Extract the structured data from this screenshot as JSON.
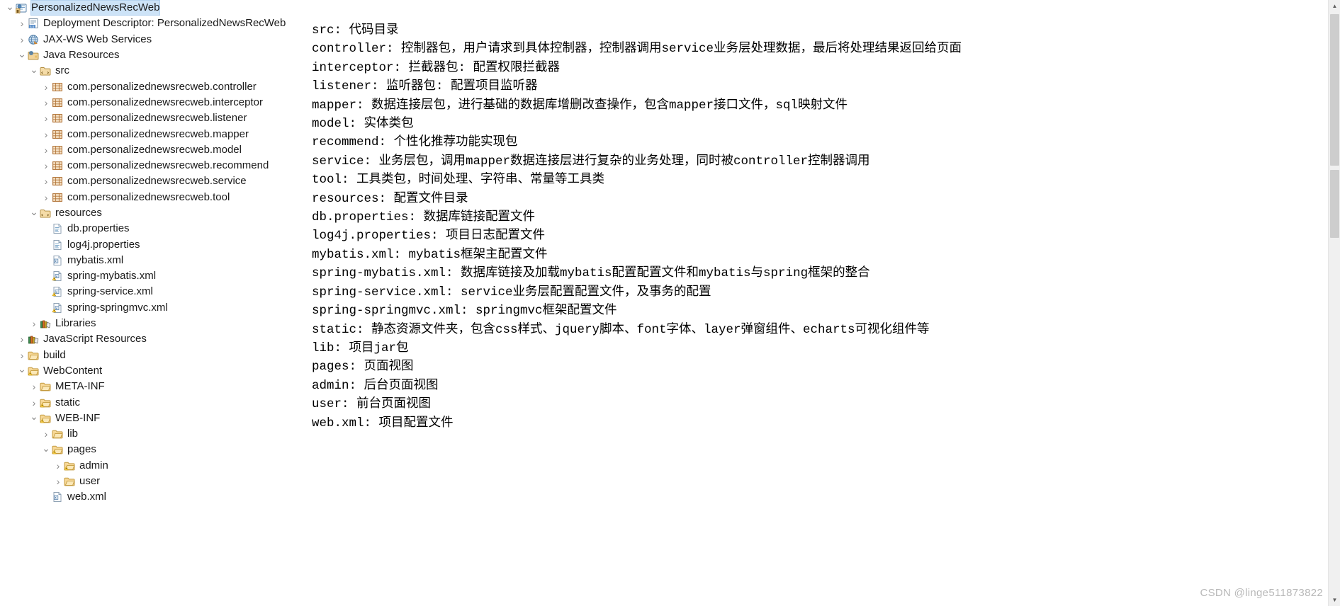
{
  "tree": {
    "items": [
      {
        "label": "PersonalizedNewsRecWeb",
        "depth": 0,
        "twisty": "expanded",
        "icon": "java-web-project-icon",
        "selected": true
      },
      {
        "label": "Deployment Descriptor: PersonalizedNewsRecWeb",
        "depth": 1,
        "twisty": "collapsed",
        "icon": "deployment-descriptor-icon",
        "selected": false
      },
      {
        "label": "JAX-WS Web Services",
        "depth": 1,
        "twisty": "collapsed",
        "icon": "jaxws-icon",
        "selected": false
      },
      {
        "label": "Java Resources",
        "depth": 1,
        "twisty": "expanded",
        "icon": "java-resources-icon",
        "selected": false
      },
      {
        "label": "src",
        "depth": 2,
        "twisty": "expanded",
        "icon": "source-folder-icon",
        "selected": false
      },
      {
        "label": "com.personalizednewsrecweb.controller",
        "depth": 3,
        "twisty": "collapsed",
        "icon": "package-icon",
        "selected": false
      },
      {
        "label": "com.personalizednewsrecweb.interceptor",
        "depth": 3,
        "twisty": "collapsed",
        "icon": "package-icon",
        "selected": false
      },
      {
        "label": "com.personalizednewsrecweb.listener",
        "depth": 3,
        "twisty": "collapsed",
        "icon": "package-icon",
        "selected": false
      },
      {
        "label": "com.personalizednewsrecweb.mapper",
        "depth": 3,
        "twisty": "collapsed",
        "icon": "package-icon",
        "selected": false
      },
      {
        "label": "com.personalizednewsrecweb.model",
        "depth": 3,
        "twisty": "collapsed",
        "icon": "package-icon",
        "selected": false
      },
      {
        "label": "com.personalizednewsrecweb.recommend",
        "depth": 3,
        "twisty": "collapsed",
        "icon": "package-icon",
        "selected": false
      },
      {
        "label": "com.personalizednewsrecweb.service",
        "depth": 3,
        "twisty": "collapsed",
        "icon": "package-icon",
        "selected": false
      },
      {
        "label": "com.personalizednewsrecweb.tool",
        "depth": 3,
        "twisty": "collapsed",
        "icon": "package-icon",
        "selected": false
      },
      {
        "label": "resources",
        "depth": 2,
        "twisty": "expanded",
        "icon": "source-folder-icon",
        "selected": false
      },
      {
        "label": "db.properties",
        "depth": 3,
        "twisty": "none",
        "icon": "properties-file-icon",
        "selected": false
      },
      {
        "label": "log4j.properties",
        "depth": 3,
        "twisty": "none",
        "icon": "properties-file-icon",
        "selected": false
      },
      {
        "label": "mybatis.xml",
        "depth": 3,
        "twisty": "none",
        "icon": "xml-file-icon",
        "selected": false
      },
      {
        "label": "spring-mybatis.xml",
        "depth": 3,
        "twisty": "none",
        "icon": "xml-warning-file-icon",
        "selected": false
      },
      {
        "label": "spring-service.xml",
        "depth": 3,
        "twisty": "none",
        "icon": "xml-warning-file-icon",
        "selected": false
      },
      {
        "label": "spring-springmvc.xml",
        "depth": 3,
        "twisty": "none",
        "icon": "xml-warning-file-icon",
        "selected": false
      },
      {
        "label": "Libraries",
        "depth": 2,
        "twisty": "collapsed",
        "icon": "libraries-icon",
        "selected": false
      },
      {
        "label": "JavaScript Resources",
        "depth": 1,
        "twisty": "collapsed",
        "icon": "libraries-icon",
        "selected": false
      },
      {
        "label": "build",
        "depth": 1,
        "twisty": "collapsed",
        "icon": "folder-icon",
        "selected": false
      },
      {
        "label": "WebContent",
        "depth": 1,
        "twisty": "expanded",
        "icon": "folder-warning-icon",
        "selected": false
      },
      {
        "label": "META-INF",
        "depth": 2,
        "twisty": "collapsed",
        "icon": "folder-icon",
        "selected": false
      },
      {
        "label": "static",
        "depth": 2,
        "twisty": "collapsed",
        "icon": "folder-warning-icon",
        "selected": false
      },
      {
        "label": "WEB-INF",
        "depth": 2,
        "twisty": "expanded",
        "icon": "folder-warning-icon",
        "selected": false
      },
      {
        "label": "lib",
        "depth": 3,
        "twisty": "collapsed",
        "icon": "folder-icon",
        "selected": false
      },
      {
        "label": "pages",
        "depth": 3,
        "twisty": "expanded",
        "icon": "folder-warning-icon",
        "selected": false
      },
      {
        "label": "admin",
        "depth": 4,
        "twisty": "collapsed",
        "icon": "folder-warning-icon",
        "selected": false
      },
      {
        "label": "user",
        "depth": 4,
        "twisty": "collapsed",
        "icon": "folder-icon",
        "selected": false
      },
      {
        "label": "web.xml",
        "depth": 3,
        "twisty": "none",
        "icon": "xml-file-icon",
        "selected": false
      }
    ]
  },
  "doc": {
    "lines": [
      "src: 代码目录",
      "controller: 控制器包，用户请求到具体控制器，控制器调用service业务层处理数据，最后将处理结果返回给页面",
      "interceptor: 拦截器包: 配置权限拦截器",
      "listener: 监听器包: 配置项目监听器",
      "mapper: 数据连接层包，进行基础的数据库增删改查操作，包含mapper接口文件，sql映射文件",
      "model: 实体类包",
      "recommend: 个性化推荐功能实现包",
      "service: 业务层包，调用mapper数据连接层进行复杂的业务处理，同时被controller控制器调用",
      "tool: 工具类包，时间处理、字符串、常量等工具类",
      "resources: 配置文件目录",
      "db.properties: 数据库链接配置文件",
      "log4j.properties: 项目日志配置文件",
      "mybatis.xml: mybatis框架主配置文件",
      "spring-mybatis.xml: 数据库链接及加载mybatis配置配置文件和mybatis与spring框架的整合",
      "spring-service.xml: service业务层配置配置文件，及事务的配置",
      "spring-springmvc.xml: springmvc框架配置文件",
      "static: 静态资源文件夹，包含css样式、jquery脚本、font字体、layer弹窗组件、echarts可视化组件等",
      "lib: 项目jar包",
      "pages: 页面视图",
      "admin: 后台页面视图",
      "user: 前台页面视图",
      "web.xml: 项目配置文件"
    ]
  },
  "scrollbar": {
    "up_arrow": "▲",
    "down_arrow": "▼"
  },
  "watermark": {
    "text": "CSDN @linge511873822"
  },
  "colors": {
    "selection": "#cde3f7",
    "folder": "#f0c070",
    "package": "#c08a50",
    "text": "#1a1a1a",
    "watermark": "#b8b8b8"
  }
}
